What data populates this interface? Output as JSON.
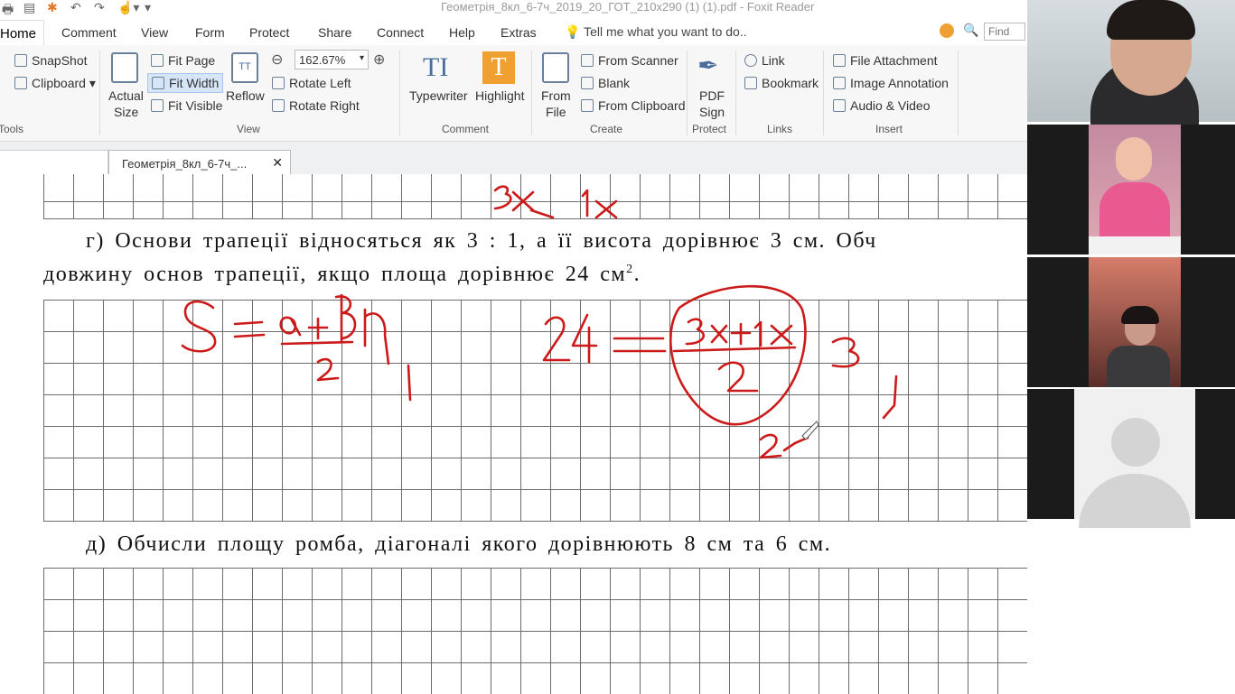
{
  "window": {
    "title": "Геометрія_8кл_6-7ч_2019_20_ГОТ_210x290 (1) (1).pdf - Foxit Reader"
  },
  "menu": {
    "items": [
      "Home",
      "Comment",
      "View",
      "Form",
      "Protect",
      "Share",
      "Connect",
      "Help",
      "Extras"
    ],
    "tell_me": "Tell me what you want to do..",
    "find_placeholder": "Find"
  },
  "ribbon": {
    "tools": {
      "snapshot": "SnapShot",
      "clipboard": "Clipboard",
      "group": "Tools"
    },
    "view": {
      "actual_size_1": "Actual",
      "actual_size_2": "Size",
      "fit_page": "Fit Page",
      "fit_width": "Fit Width",
      "fit_visible": "Fit Visible",
      "reflow": "Reflow",
      "zoom": "162.67%",
      "rotate_left": "Rotate Left",
      "rotate_right": "Rotate Right",
      "group": "View"
    },
    "comment": {
      "typewriter": "Typewriter",
      "highlight": "Highlight",
      "group": "Comment"
    },
    "create": {
      "from_file_1": "From",
      "from_file_2": "File",
      "from_scanner": "From Scanner",
      "blank": "Blank",
      "from_clipboard": "From Clipboard",
      "group": "Create"
    },
    "protect": {
      "pdf_sign_1": "PDF",
      "pdf_sign_2": "Sign",
      "group": "Protect"
    },
    "links": {
      "link": "Link",
      "bookmark": "Bookmark",
      "group": "Links"
    },
    "insert": {
      "file_attachment": "File Attachment",
      "image_annotation": "Image Annotation",
      "audio_video": "Audio & Video",
      "group": "Insert"
    }
  },
  "tabs": [
    {
      "label": "Геометрія_8кл_6-7ч_..."
    }
  ],
  "document": {
    "task_g_line1": "г) Основи трапеції відносяться як 3 : 1, а її висота дорівнює 3 см. Обч",
    "task_g_line2": "довжину основ трапеції, якщо площа дорівнює 24 см",
    "task_g_sup": "2",
    "task_g_end": ".",
    "task_d": "д) Обчисли площу ромба, діагоналі якого дорівнюють 8 см та 6 см."
  },
  "colors": {
    "ink": "#cc1a1a",
    "ribbon_bg": "#f7f7f7",
    "accent": "#f0a030"
  }
}
